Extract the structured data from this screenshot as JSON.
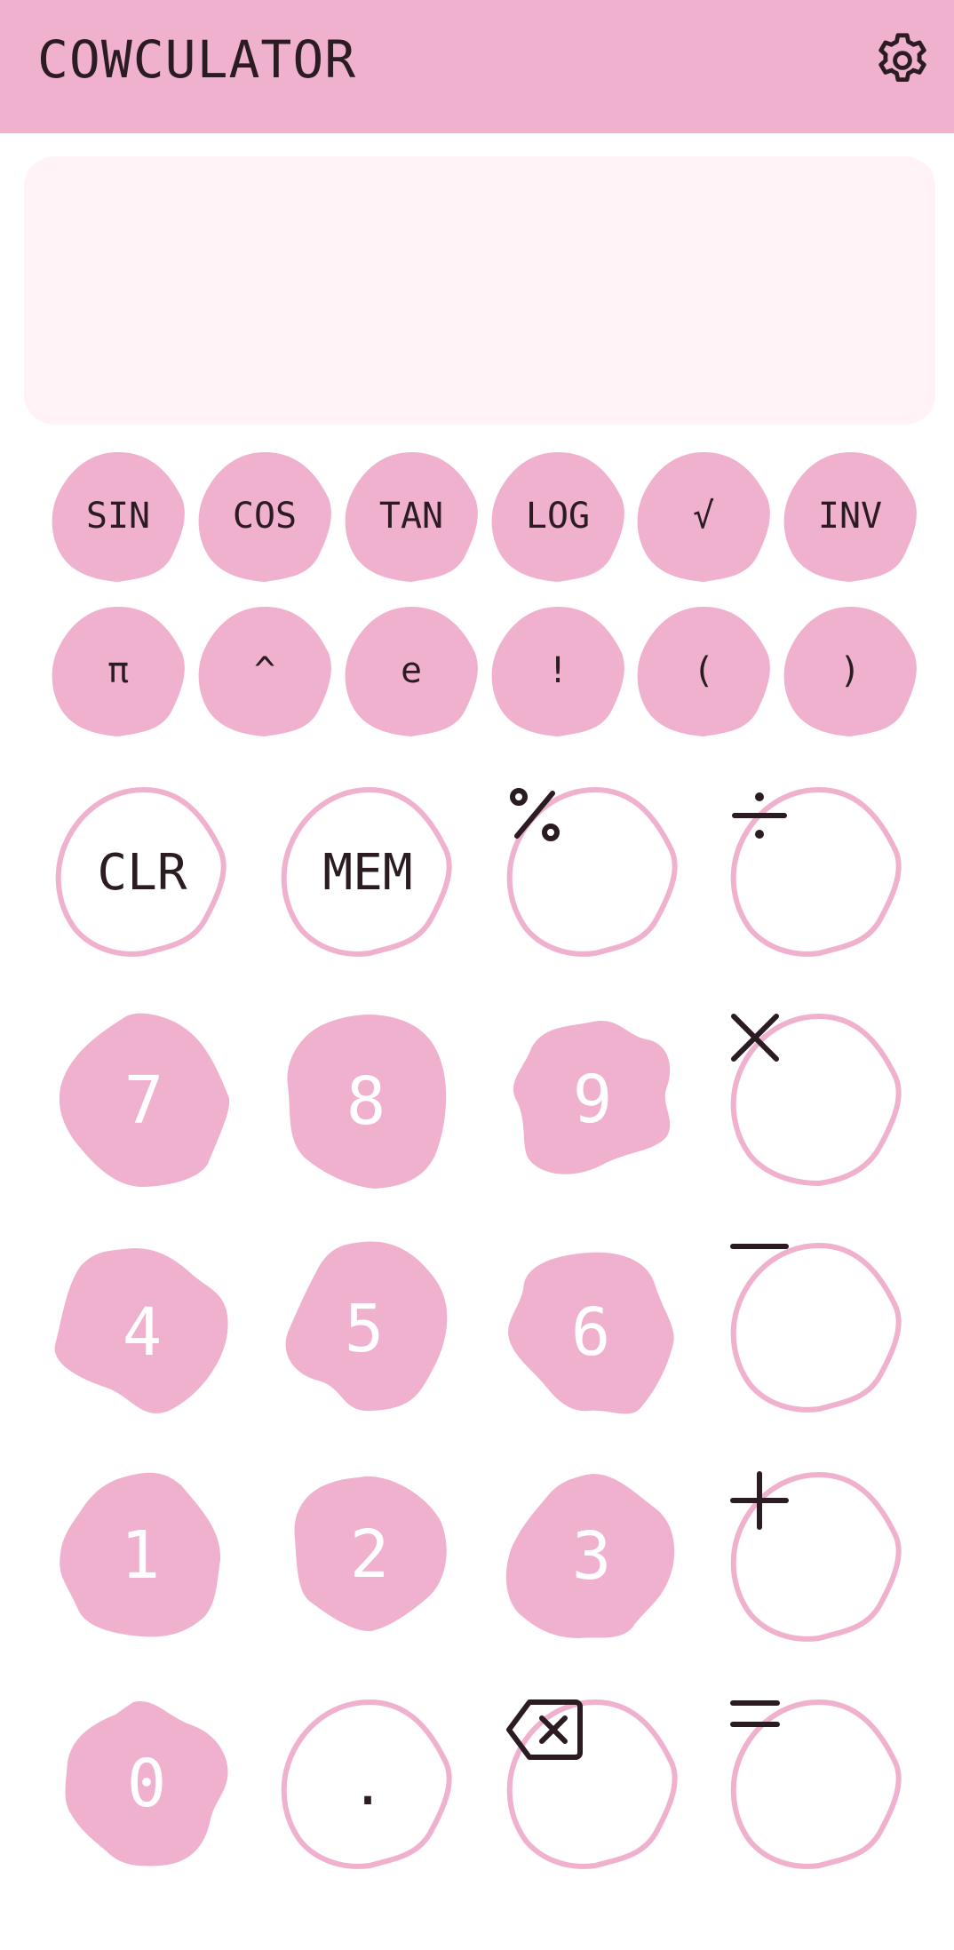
{
  "app": {
    "title": "COWCULATOR",
    "settings_icon": "gear-icon",
    "accent_color": "#f0b1ce",
    "display_bg": "#fff3f8",
    "text_color": "#2a1c22"
  },
  "display": {
    "expression": ""
  },
  "scientific_row_1": [
    {
      "id": "sin",
      "label": "SIN"
    },
    {
      "id": "cos",
      "label": "COS"
    },
    {
      "id": "tan",
      "label": "TAN"
    },
    {
      "id": "log",
      "label": "LOG"
    },
    {
      "id": "sqrt",
      "label": "√"
    },
    {
      "id": "inv",
      "label": "INV"
    }
  ],
  "scientific_row_2": [
    {
      "id": "pi",
      "label": "π"
    },
    {
      "id": "power",
      "label": "^"
    },
    {
      "id": "euler",
      "label": "e"
    },
    {
      "id": "factorial",
      "label": "!"
    },
    {
      "id": "open-paren",
      "label": "("
    },
    {
      "id": "close-paren",
      "label": ")"
    }
  ],
  "keypad": {
    "clear": "CLR",
    "memory": "MEM",
    "percent_icon": "percent-icon",
    "divide_icon": "divide-icon",
    "multiply_icon": "multiply-icon",
    "minus_icon": "minus-icon",
    "plus_icon": "plus-icon",
    "equals_icon": "equals-icon",
    "backspace_icon": "backspace-icon",
    "decimal": ".",
    "digits": {
      "d7": "7",
      "d8": "8",
      "d9": "9",
      "d4": "4",
      "d5": "5",
      "d6": "6",
      "d1": "1",
      "d2": "2",
      "d3": "3",
      "d0": "0"
    }
  }
}
